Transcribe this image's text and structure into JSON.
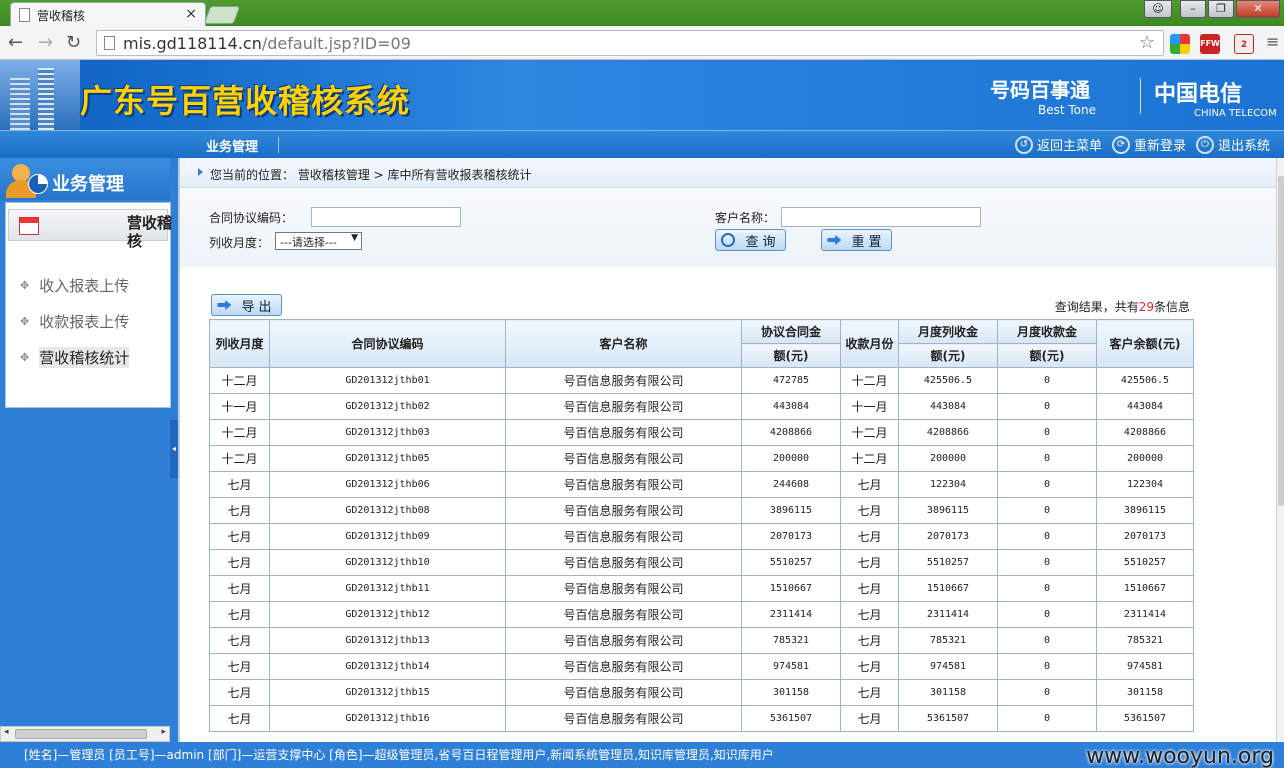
{
  "browser": {
    "tab_title": "营收稽核",
    "tab_close": "×",
    "url_host": "mis.gd118114.cn",
    "url_path": "/default.jsp?ID=09",
    "ext_badge": "2"
  },
  "header": {
    "system_title": "广东号百营收稽核系统",
    "brand_besttone_cn": "号码百事通",
    "brand_besttone_en": "Best Tone",
    "brand_telecom_cn": "中国电信",
    "brand_telecom_en": "CHINA TELECOM"
  },
  "menubar": {
    "item": "业务管理",
    "links": [
      "返回主菜单",
      "重新登录",
      "退出系统"
    ]
  },
  "sidebar": {
    "title": "业务管理",
    "panel_title": "营收稽核",
    "items": [
      {
        "label": "收入报表上传"
      },
      {
        "label": "收款报表上传"
      },
      {
        "label": "营收稽核统计"
      }
    ]
  },
  "breadcrumb": {
    "prefix": "您当前的位置：",
    "path": "营收稽核管理 > 库中所有营收报表稽核统计"
  },
  "search": {
    "contract_label": "合同协议编码：",
    "contract_value": "",
    "customer_label": "客户名称：",
    "customer_value": "",
    "month_label": "列收月度：",
    "month_selected": "---请选择---",
    "query_button": "查询",
    "reset_button": "重置"
  },
  "export_button": "导出",
  "result": {
    "prefix": "查询结果，共有",
    "count": "29",
    "suffix": "条信息"
  },
  "table": {
    "headers": {
      "month": "列收月度",
      "contract": "合同协议编码",
      "customer": "客户名称",
      "amount_top": "协议合同金",
      "amount_bottom": "额(元)",
      "pay_month": "收款月份",
      "recv_top": "月度列收金",
      "recv_bottom": "额(元)",
      "paid_top": "月度收款金",
      "paid_bottom": "额(元)",
      "balance": "客户余额(元)"
    },
    "rows": [
      [
        "十二月",
        "GD201312jthb01",
        "号百信息服务有限公司",
        "472785",
        "十二月",
        "425506.5",
        "0",
        "425506.5"
      ],
      [
        "十一月",
        "GD201312jthb02",
        "号百信息服务有限公司",
        "443084",
        "十一月",
        "443084",
        "0",
        "443084"
      ],
      [
        "十二月",
        "GD201312jthb03",
        "号百信息服务有限公司",
        "4208866",
        "十二月",
        "4208866",
        "0",
        "4208866"
      ],
      [
        "十二月",
        "GD201312jthb05",
        "号百信息服务有限公司",
        "200000",
        "十二月",
        "200000",
        "0",
        "200000"
      ],
      [
        "七月",
        "GD201312jthb06",
        "号百信息服务有限公司",
        "244608",
        "七月",
        "122304",
        "0",
        "122304"
      ],
      [
        "七月",
        "GD201312jthb08",
        "号百信息服务有限公司",
        "3896115",
        "七月",
        "3896115",
        "0",
        "3896115"
      ],
      [
        "七月",
        "GD201312jthb09",
        "号百信息服务有限公司",
        "2070173",
        "七月",
        "2070173",
        "0",
        "2070173"
      ],
      [
        "七月",
        "GD201312jthb10",
        "号百信息服务有限公司",
        "5510257",
        "七月",
        "5510257",
        "0",
        "5510257"
      ],
      [
        "七月",
        "GD201312jthb11",
        "号百信息服务有限公司",
        "1510667",
        "七月",
        "1510667",
        "0",
        "1510667"
      ],
      [
        "七月",
        "GD201312jthb12",
        "号百信息服务有限公司",
        "2311414",
        "七月",
        "2311414",
        "0",
        "2311414"
      ],
      [
        "七月",
        "GD201312jthb13",
        "号百信息服务有限公司",
        "785321",
        "七月",
        "785321",
        "0",
        "785321"
      ],
      [
        "七月",
        "GD201312jthb14",
        "号百信息服务有限公司",
        "974581",
        "七月",
        "974581",
        "0",
        "974581"
      ],
      [
        "七月",
        "GD201312jthb15",
        "号百信息服务有限公司",
        "301158",
        "七月",
        "301158",
        "0",
        "301158"
      ],
      [
        "七月",
        "GD201312jthb16",
        "号百信息服务有限公司",
        "5361507",
        "七月",
        "5361507",
        "0",
        "5361507"
      ]
    ]
  },
  "statusbar": {
    "text": "[姓名]—管理员 [员工号]—admin [部门]—运营支撑中心 [角色]—超级管理员,省号百日程管理用户,新闻系统管理员,知识库管理员,知识库用户",
    "watermark": "www.wooyun.org"
  },
  "colors": {
    "accent": "#2d7fd8",
    "title_yellow": "#ffd200",
    "count_red": "#e0242c"
  }
}
